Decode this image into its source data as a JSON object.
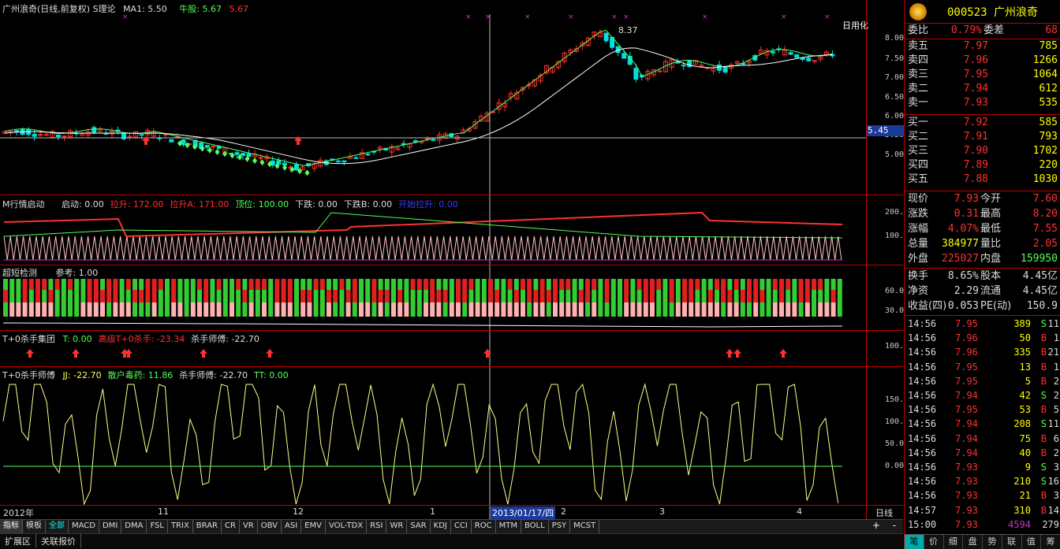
{
  "header": {
    "title": "广州浪奇(日线,前复权) S理论",
    "ma_label": "MA1: 5.50",
    "niu_label": "牛股: 5.67",
    "niu_val2": "5.67"
  },
  "main_axis": [
    "8.00",
    "7.50",
    "7.00",
    "6.50",
    "6.00",
    "5.50",
    "5.00"
  ],
  "hl_price": "5.45",
  "hl_peak": "8.37",
  "main_corner": "日用化",
  "ind1": {
    "title": "M行情启动",
    "items": [
      {
        "t": "启动: 0.00",
        "c": "#ddd"
      },
      {
        "t": "拉升: 172.00",
        "c": "#ff3030"
      },
      {
        "t": "拉升A: 171.00",
        "c": "#ff3030"
      },
      {
        "t": "顶位: 100.00",
        "c": "#55ff55"
      },
      {
        "t": "下跌: 0.00",
        "c": "#ddd"
      },
      {
        "t": "下跌B: 0.00",
        "c": "#ddd"
      },
      {
        "t": "开始拉升: 0.00",
        "c": "#3a3aff"
      }
    ],
    "axis": [
      "200.0",
      "100.0"
    ]
  },
  "ind2": {
    "title": "超短检测",
    "ref": "参考: 1.00",
    "axis": [
      "60.00",
      "30.00"
    ]
  },
  "ind3": {
    "title": "T+0杀手集团",
    "items": [
      {
        "t": "T: 0.00",
        "c": "#55ff55"
      },
      {
        "t": "高级T+0杀手: -23.34",
        "c": "#ff3030"
      },
      {
        "t": "杀手师傅: -22.70",
        "c": "#ddd"
      }
    ],
    "axis": [
      "100.0"
    ]
  },
  "ind4": {
    "title": "T+0杀手师傅",
    "items": [
      {
        "t": "JJ: -22.70",
        "c": "#ffff66"
      },
      {
        "t": "散户毒药: 11.86",
        "c": "#55ff55"
      },
      {
        "t": "杀手师傅: -22.70",
        "c": "#ddd"
      },
      {
        "t": "TT: 0.00",
        "c": "#55ff55"
      }
    ],
    "axis": [
      "150.0",
      "100.0",
      "50.00",
      "0.00"
    ]
  },
  "dates": [
    "2012年",
    "11",
    "12",
    "1",
    "2013/01/17/四",
    "2",
    "3",
    "4"
  ],
  "date_corner": "日线",
  "tabs": [
    "指标",
    "模板",
    "全部",
    "MACD",
    "DMI",
    "DMA",
    "FSL",
    "TRIX",
    "BRAR",
    "CR",
    "VR",
    "OBV",
    "ASI",
    "EMV",
    "VOL-TDX",
    "RSI",
    "WR",
    "SAR",
    "KDJ",
    "CCI",
    "ROC",
    "MTM",
    "BOLL",
    "PSY",
    "MCST"
  ],
  "tabs_right": [
    "+",
    "-"
  ],
  "bottom_links": [
    "扩展区",
    "关联报价"
  ],
  "panel": {
    "code": "000523",
    "name": "广州浪奇",
    "weibi": {
      "n": "委比",
      "v": "0.79%",
      "n2": "委差",
      "v2": "68"
    },
    "sell": [
      {
        "n": "卖五",
        "p": "7.97",
        "v": "785"
      },
      {
        "n": "卖四",
        "p": "7.96",
        "v": "1266"
      },
      {
        "n": "卖三",
        "p": "7.95",
        "v": "1064"
      },
      {
        "n": "卖二",
        "p": "7.94",
        "v": "612"
      },
      {
        "n": "卖一",
        "p": "7.93",
        "v": "535"
      }
    ],
    "buy": [
      {
        "n": "买一",
        "p": "7.92",
        "v": "585"
      },
      {
        "n": "买二",
        "p": "7.91",
        "v": "793"
      },
      {
        "n": "买三",
        "p": "7.90",
        "v": "1702"
      },
      {
        "n": "买四",
        "p": "7.89",
        "v": "220"
      },
      {
        "n": "买五",
        "p": "7.88",
        "v": "1030"
      }
    ],
    "stats": [
      {
        "a": "现价",
        "av": "7.93",
        "ac": "#ff3030",
        "b": "今开",
        "bv": "7.60",
        "bc": "#ff3030"
      },
      {
        "a": "涨跌",
        "av": "0.31",
        "ac": "#ff3030",
        "b": "最高",
        "bv": "8.20",
        "bc": "#ff3030"
      },
      {
        "a": "涨幅",
        "av": "4.07%",
        "ac": "#ff3030",
        "b": "最低",
        "bv": "7.55",
        "bc": "#ff3030"
      },
      {
        "a": "总量",
        "av": "384977",
        "ac": "#ff0",
        "b": "量比",
        "bv": "2.05",
        "bc": "#ff3030"
      },
      {
        "a": "外盘",
        "av": "225027",
        "ac": "#ff3030",
        "b": "内盘",
        "bv": "159950",
        "bc": "#55ff55"
      }
    ],
    "stats2": [
      {
        "a": "换手",
        "av": "8.65%",
        "ac": "#ddd",
        "b": "股本",
        "bv": "4.45亿",
        "bc": "#ddd"
      },
      {
        "a": "净资",
        "av": "2.29",
        "ac": "#ddd",
        "b": "流通",
        "bv": "4.45亿",
        "bc": "#ddd"
      },
      {
        "a": "收益(四)",
        "av": "0.053",
        "ac": "#ddd",
        "b": "PE(动)",
        "bv": "150.9",
        "bc": "#ddd"
      }
    ],
    "ticks": [
      {
        "t": "14:56",
        "p": "7.95",
        "v": "389",
        "s": "S",
        "c": "11"
      },
      {
        "t": "14:56",
        "p": "7.96",
        "v": "50",
        "s": "B",
        "c": "1"
      },
      {
        "t": "14:56",
        "p": "7.96",
        "v": "335",
        "s": "B",
        "c": "21"
      },
      {
        "t": "14:56",
        "p": "7.95",
        "v": "13",
        "s": "B",
        "c": "1"
      },
      {
        "t": "14:56",
        "p": "7.95",
        "v": "5",
        "s": "B",
        "c": "2"
      },
      {
        "t": "14:56",
        "p": "7.94",
        "v": "42",
        "s": "S",
        "c": "2"
      },
      {
        "t": "14:56",
        "p": "7.95",
        "v": "53",
        "s": "B",
        "c": "5"
      },
      {
        "t": "14:56",
        "p": "7.94",
        "v": "208",
        "s": "S",
        "c": "11"
      },
      {
        "t": "14:56",
        "p": "7.94",
        "v": "75",
        "s": "B",
        "c": "6"
      },
      {
        "t": "14:56",
        "p": "7.94",
        "v": "40",
        "s": "B",
        "c": "2"
      },
      {
        "t": "14:56",
        "p": "7.93",
        "v": "9",
        "s": "S",
        "c": "3"
      },
      {
        "t": "14:56",
        "p": "7.93",
        "v": "210",
        "s": "S",
        "c": "16"
      },
      {
        "t": "14:56",
        "p": "7.93",
        "v": "21",
        "s": "B",
        "c": "3"
      },
      {
        "t": "14:57",
        "p": "7.93",
        "v": "310",
        "s": "B",
        "c": "14"
      },
      {
        "t": "15:00",
        "p": "7.93",
        "v": "4594",
        "s": "",
        "c": "279"
      }
    ],
    "tabs": [
      "笔",
      "价",
      "细",
      "盘",
      "势",
      "联",
      "值",
      "筹"
    ]
  }
}
